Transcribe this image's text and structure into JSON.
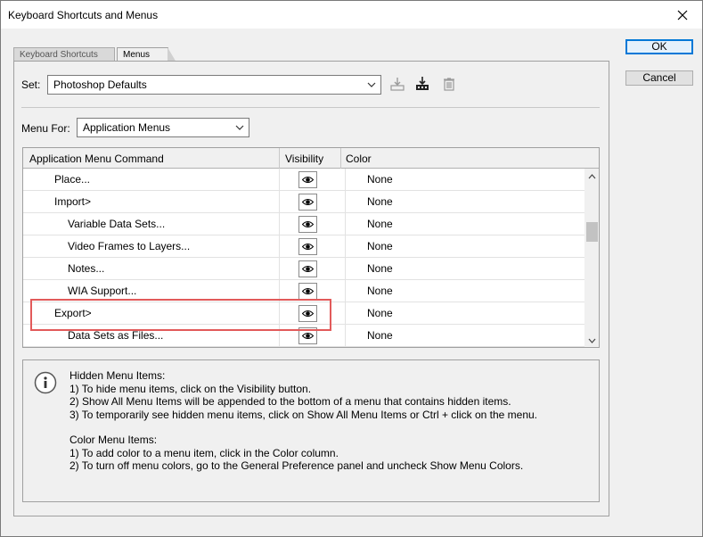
{
  "window": {
    "title": "Keyboard Shortcuts and Menus"
  },
  "tabs": [
    {
      "label": "Keyboard Shortcuts",
      "active": false
    },
    {
      "label": "Menus",
      "active": true
    }
  ],
  "set": {
    "label": "Set:",
    "value": "Photoshop Defaults"
  },
  "menu_for": {
    "label": "Menu For:",
    "value": "Application Menus"
  },
  "table": {
    "columns": [
      "Application Menu Command",
      "Visibility",
      "Color"
    ],
    "rows": [
      {
        "command": "Place...",
        "indent": 1,
        "color": "None"
      },
      {
        "command": "Import>",
        "indent": 1,
        "color": "None"
      },
      {
        "command": "Variable Data Sets...",
        "indent": 2,
        "color": "None"
      },
      {
        "command": "Video Frames to Layers...",
        "indent": 2,
        "color": "None"
      },
      {
        "command": "Notes...",
        "indent": 2,
        "color": "None"
      },
      {
        "command": "WIA Support...",
        "indent": 2,
        "color": "None"
      },
      {
        "command": "Export>",
        "indent": 1,
        "color": "None"
      },
      {
        "command": "Data Sets as Files...",
        "indent": 2,
        "color": "None"
      }
    ]
  },
  "info": {
    "lines": [
      "Hidden Menu Items:",
      "1) To hide menu items, click on the Visibility button.",
      "2) Show All Menu Items will be appended to the bottom of a menu that contains hidden items.",
      "3) To temporarily see hidden menu items, click on Show All Menu Items or Ctrl + click on the menu.",
      "",
      "Color Menu Items:",
      "1) To add color to a menu item, click in the Color column.",
      "2) To turn off menu colors, go to the General Preference panel and uncheck Show Menu Colors."
    ]
  },
  "buttons": {
    "ok": "OK",
    "cancel": "Cancel"
  },
  "icons": {
    "close": "close-icon",
    "save": "save-set-icon",
    "new_set": "new-set-icon",
    "delete": "trash-icon",
    "visibility": "eye-icon",
    "info": "info-icon"
  },
  "colors": {
    "highlight": "#e25a5a",
    "accent": "#0078d7"
  }
}
